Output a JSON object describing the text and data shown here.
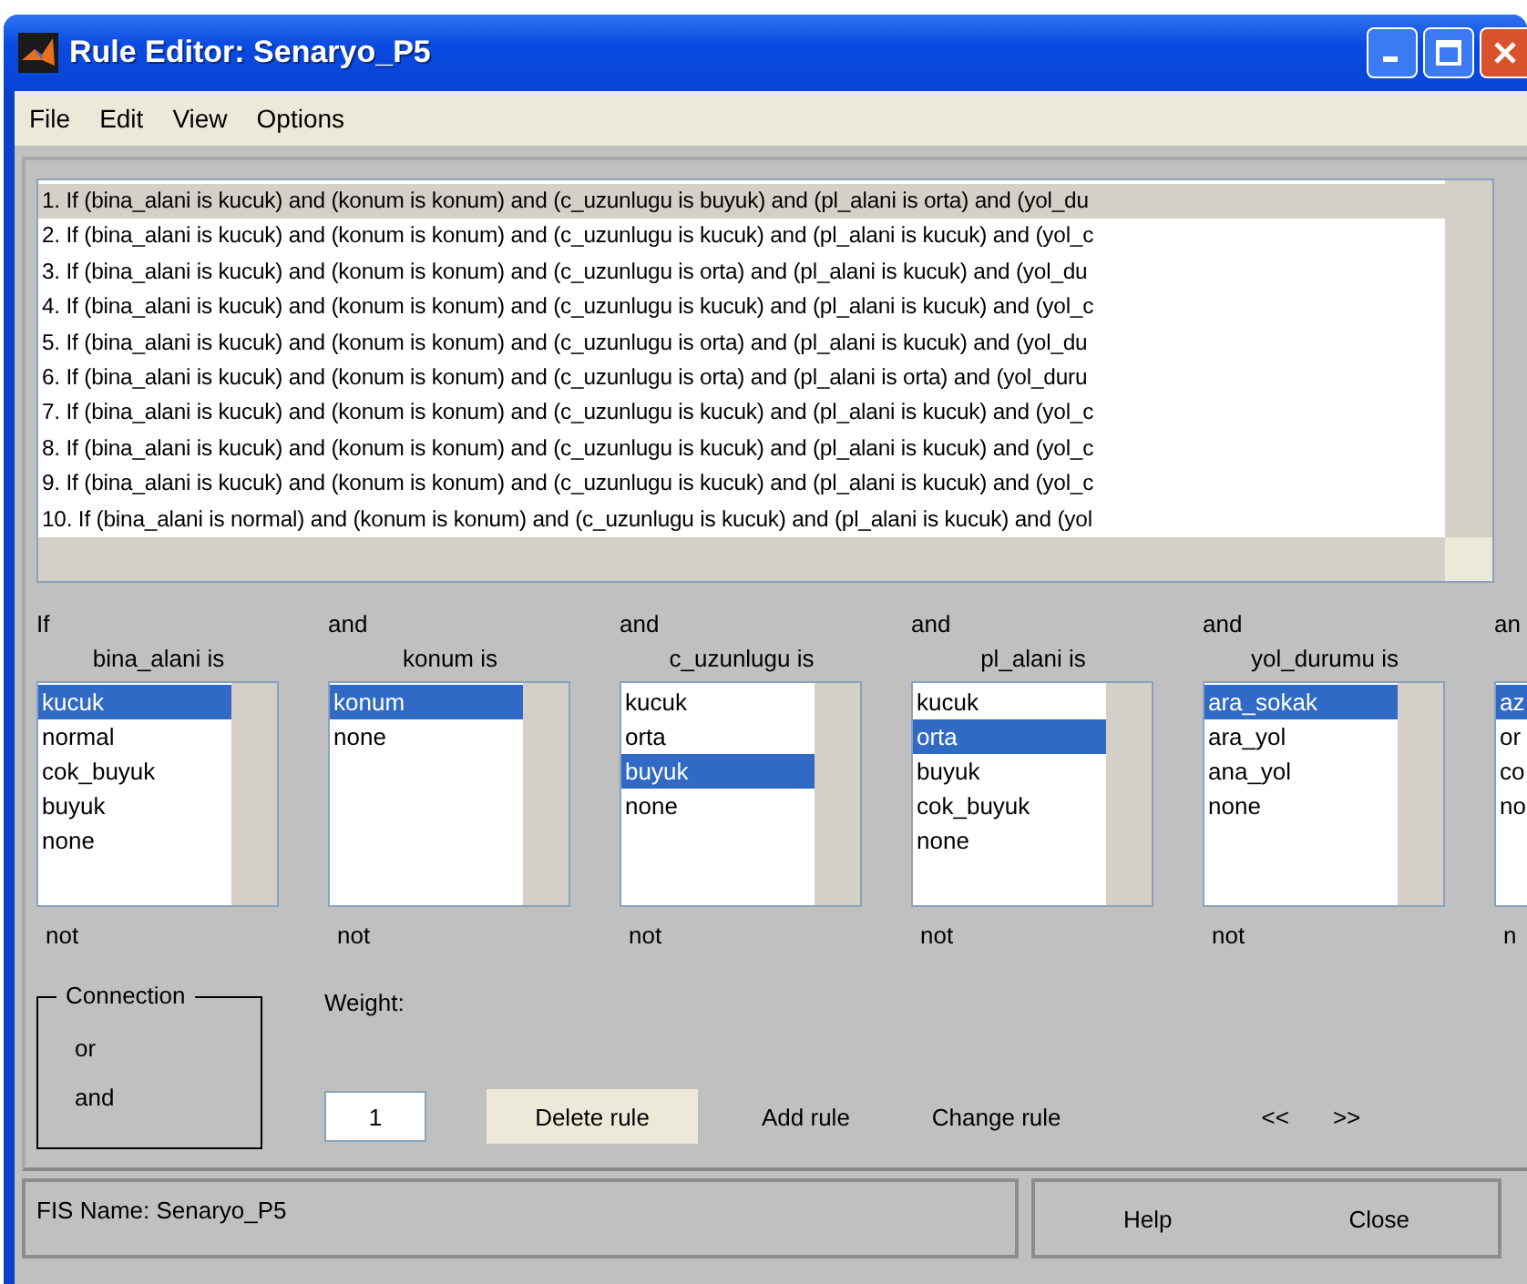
{
  "window": {
    "title": "Rule Editor: Senaryo_P5"
  },
  "menu": [
    "File",
    "Edit",
    "View",
    "Options"
  ],
  "rules": [
    {
      "text": "1. If (bina_alani is kucuk) and (konum is konum) and (c_uzunlugu is buyuk) and (pl_alani is orta) and (yol_du",
      "selected": true
    },
    {
      "text": "2. If (bina_alani is kucuk) and (konum is konum) and (c_uzunlugu is kucuk) and (pl_alani is kucuk) and (yol_c",
      "selected": false
    },
    {
      "text": "3. If (bina_alani is kucuk) and (konum is konum) and (c_uzunlugu is orta) and (pl_alani is kucuk) and (yol_du",
      "selected": false
    },
    {
      "text": "4. If (bina_alani is kucuk) and (konum is konum) and (c_uzunlugu is kucuk) and (pl_alani is kucuk) and (yol_c",
      "selected": false
    },
    {
      "text": "5. If (bina_alani is kucuk) and (konum is konum) and (c_uzunlugu is orta) and (pl_alani is kucuk) and (yol_du",
      "selected": false
    },
    {
      "text": "6. If (bina_alani is kucuk) and (konum is konum) and (c_uzunlugu is orta) and (pl_alani is orta) and (yol_duru",
      "selected": false
    },
    {
      "text": "7. If (bina_alani is kucuk) and (konum is konum) and (c_uzunlugu is kucuk) and (pl_alani is kucuk) and (yol_c",
      "selected": false
    },
    {
      "text": "8. If (bina_alani is kucuk) and (konum is konum) and (c_uzunlugu is kucuk) and (pl_alani is kucuk) and (yol_c",
      "selected": false
    },
    {
      "text": "9. If (bina_alani is kucuk) and (konum is konum) and (c_uzunlugu is kucuk) and (pl_alani is kucuk) and (yol_c",
      "selected": false
    },
    {
      "text": "10. If (bina_alani is normal) and (konum is konum) and (c_uzunlugu is kucuk) and (pl_alani is kucuk) and (yol",
      "selected": false
    }
  ],
  "inputs": [
    {
      "connective": "If",
      "variable": "bina_alani is",
      "not_label": "not",
      "options": [
        {
          "label": "kucuk",
          "selected": true
        },
        {
          "label": "normal",
          "selected": false
        },
        {
          "label": "cok_buyuk",
          "selected": false
        },
        {
          "label": "buyuk",
          "selected": false
        },
        {
          "label": "none",
          "selected": false
        }
      ]
    },
    {
      "connective": "and",
      "variable": "konum is",
      "not_label": "not",
      "options": [
        {
          "label": "konum",
          "selected": true
        },
        {
          "label": "none",
          "selected": false
        }
      ]
    },
    {
      "connective": "and",
      "variable": "c_uzunlugu is",
      "not_label": "not",
      "options": [
        {
          "label": "kucuk",
          "selected": false
        },
        {
          "label": "orta",
          "selected": false
        },
        {
          "label": "buyuk",
          "selected": true
        },
        {
          "label": "none",
          "selected": false
        }
      ]
    },
    {
      "connective": "and",
      "variable": "pl_alani is",
      "not_label": "not",
      "options": [
        {
          "label": "kucuk",
          "selected": false
        },
        {
          "label": "orta",
          "selected": true
        },
        {
          "label": "buyuk",
          "selected": false
        },
        {
          "label": "cok_buyuk",
          "selected": false
        },
        {
          "label": "none",
          "selected": false
        }
      ]
    },
    {
      "connective": "and",
      "variable": "yol_durumu is",
      "not_label": "not",
      "options": [
        {
          "label": "ara_sokak",
          "selected": true
        },
        {
          "label": "ara_yol",
          "selected": false
        },
        {
          "label": "ana_yol",
          "selected": false
        },
        {
          "label": "none",
          "selected": false
        }
      ]
    },
    {
      "connective": "an",
      "not_label": "n",
      "options": [
        {
          "label": "az",
          "selected": true
        },
        {
          "label": "or",
          "selected": false
        },
        {
          "label": "co",
          "selected": false
        },
        {
          "label": "no",
          "selected": false
        }
      ]
    }
  ],
  "connection": {
    "title": "Connection",
    "options": [
      "or",
      "and"
    ]
  },
  "weight": {
    "label": "Weight:",
    "value": "1"
  },
  "buttons": [
    "Delete rule",
    "Add rule",
    "Change rule",
    "<<",
    ">>"
  ],
  "status": "FIS Name: Senaryo_P5",
  "footer_buttons": [
    "Help",
    "Close"
  ]
}
